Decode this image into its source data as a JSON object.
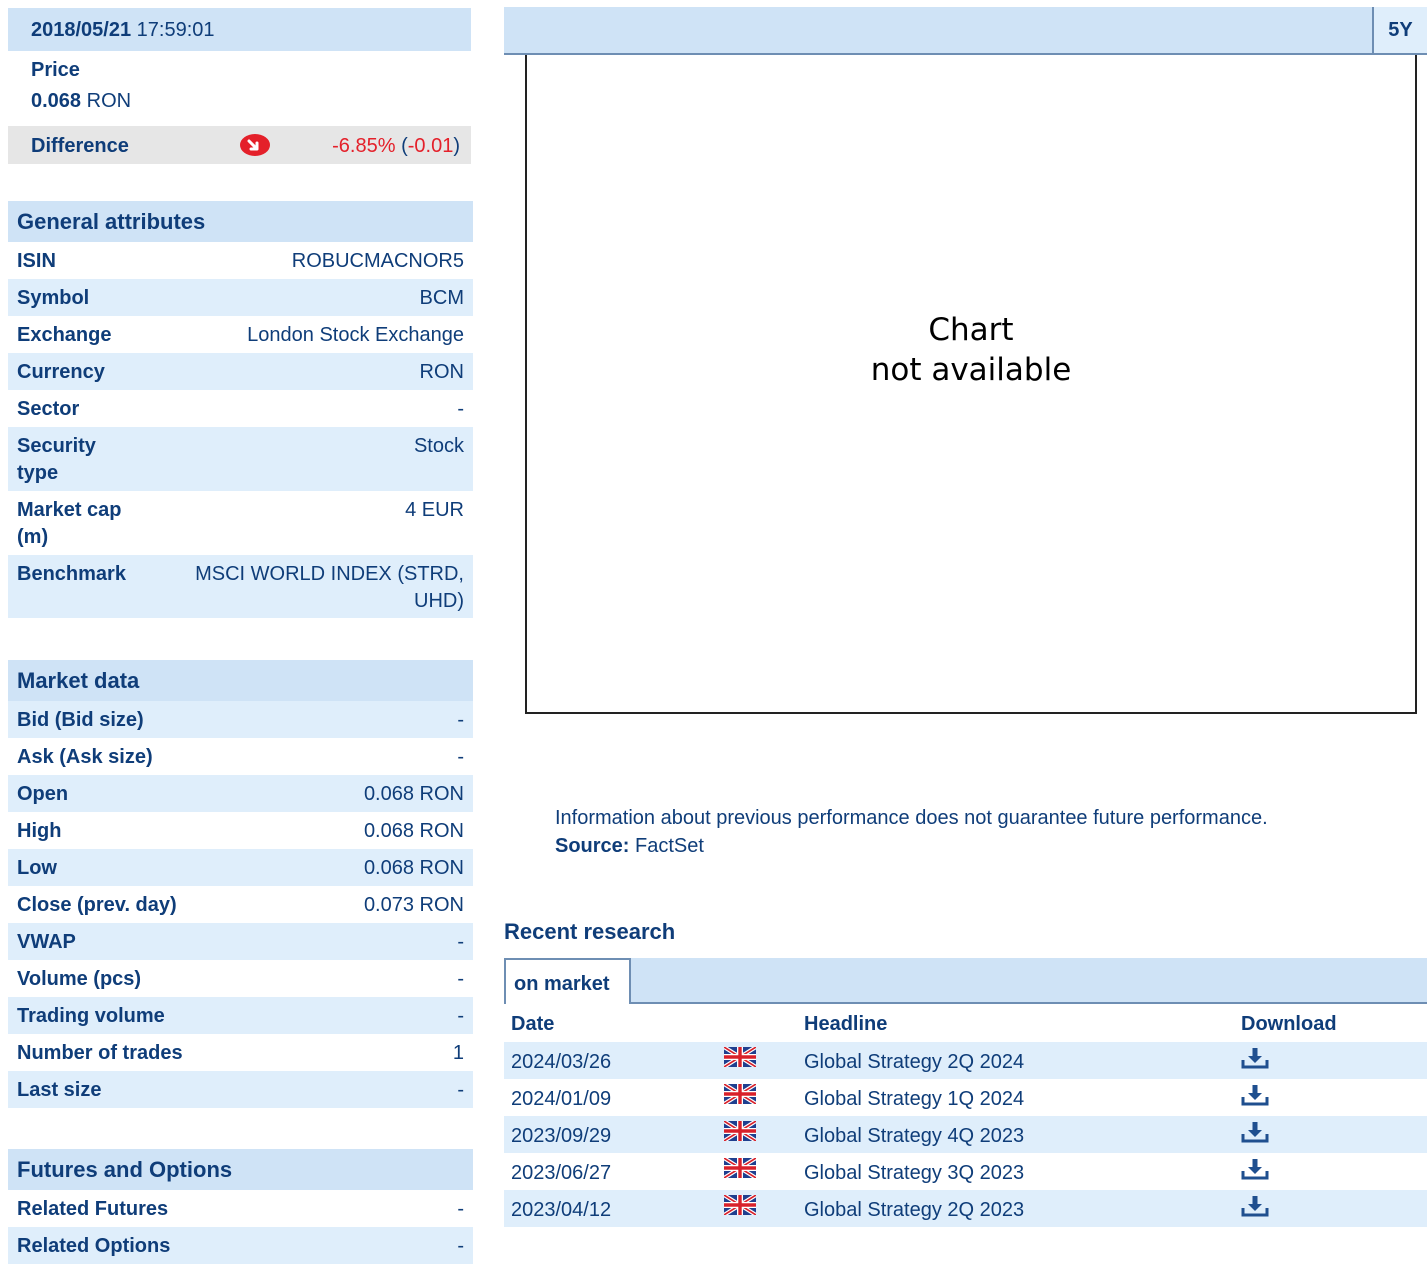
{
  "quote": {
    "date": "2018/05/21",
    "time": "17:59:01",
    "price_label": "Price",
    "price_value": "0.068",
    "price_currency": "RON",
    "difference_label": "Difference",
    "difference_pct": "-6.85%",
    "difference_abs": "-0.01",
    "difference_icon": "arrow-down-icon"
  },
  "general": {
    "title": "General attributes",
    "rows": [
      {
        "key": "ISIN",
        "value": "ROBUCMACNOR5"
      },
      {
        "key": "Symbol",
        "value": "BCM"
      },
      {
        "key": "Exchange",
        "value": "London Stock Exchange"
      },
      {
        "key": "Currency",
        "value": "RON"
      },
      {
        "key": "Sector",
        "value": "-"
      },
      {
        "key": "Security type",
        "value": "Stock"
      },
      {
        "key": "Market cap (m)",
        "value": "4 EUR"
      },
      {
        "key": "Benchmark",
        "value": "MSCI WORLD INDEX (STRD, UHD)"
      }
    ]
  },
  "market": {
    "title": "Market data",
    "rows": [
      {
        "key": "Bid (Bid size)",
        "value": "-"
      },
      {
        "key": "Ask (Ask size)",
        "value": "-"
      },
      {
        "key": "Open",
        "value": "0.068 RON"
      },
      {
        "key": "High",
        "value": "0.068 RON"
      },
      {
        "key": "Low",
        "value": "0.068 RON"
      },
      {
        "key": "Close (prev. day)",
        "value": "0.073 RON"
      },
      {
        "key": "VWAP",
        "value": "-"
      },
      {
        "key": "Volume (pcs)",
        "value": "-"
      },
      {
        "key": "Trading volume",
        "value": "-"
      },
      {
        "key": "Number of trades",
        "value": "1"
      },
      {
        "key": "Last size",
        "value": "-"
      }
    ]
  },
  "futures": {
    "title": "Futures and Options",
    "rows": [
      {
        "key": "Related Futures",
        "value": "-"
      },
      {
        "key": "Related Options",
        "value": "-"
      }
    ]
  },
  "chart": {
    "range_button": "5Y",
    "unavailable_line1": "Chart",
    "unavailable_line2": "not available"
  },
  "disclaimer": {
    "text": "Information about previous performance does not guarantee future performance.",
    "source_label": "Source:",
    "source_value": "FactSet"
  },
  "research": {
    "title": "Recent research",
    "tab": "on market",
    "headers": {
      "date": "Date",
      "headline": "Headline",
      "download": "Download"
    },
    "rows": [
      {
        "date": "2024/03/26",
        "headline": "Global Strategy 2Q 2024",
        "flag": "uk-flag-icon",
        "download": "download-icon"
      },
      {
        "date": "2024/01/09",
        "headline": "Global Strategy 1Q 2024",
        "flag": "uk-flag-icon",
        "download": "download-icon"
      },
      {
        "date": "2023/09/29",
        "headline": "Global Strategy 4Q 2023",
        "flag": "uk-flag-icon",
        "download": "download-icon"
      },
      {
        "date": "2023/06/27",
        "headline": "Global Strategy 3Q 2023",
        "flag": "uk-flag-icon",
        "download": "download-icon"
      },
      {
        "date": "2023/04/12",
        "headline": "Global Strategy 2Q 2023",
        "flag": "uk-flag-icon",
        "download": "download-icon"
      }
    ]
  }
}
